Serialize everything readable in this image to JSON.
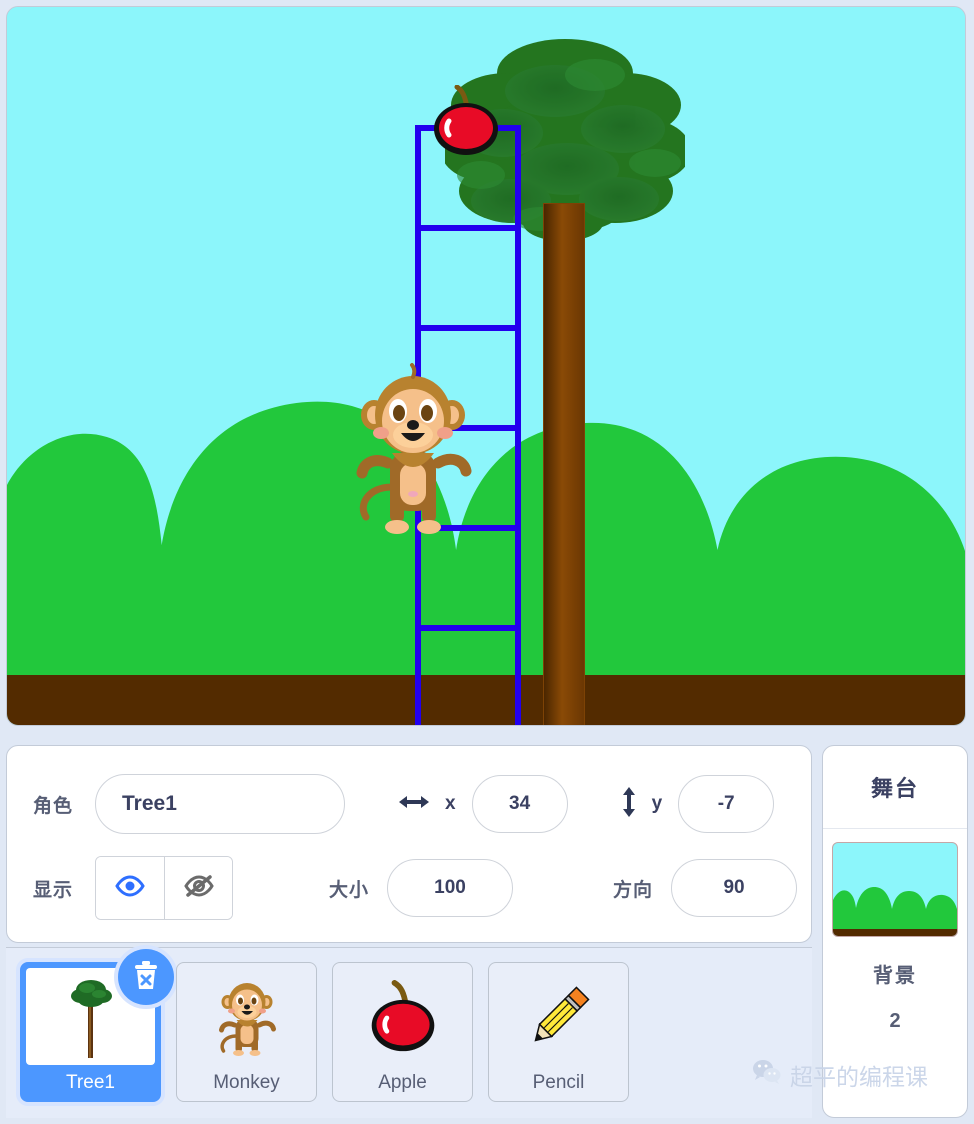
{
  "stage": {
    "sky_color": "#8cf6fb",
    "hill_color": "#22c83c",
    "dirt_color": "#532b00",
    "sprites_on_stage": [
      {
        "name": "tree-sprite",
        "icon": "tree"
      },
      {
        "name": "apple-sprite",
        "icon": "apple"
      },
      {
        "name": "monkey-sprite",
        "icon": "monkey"
      },
      {
        "name": "ladder-pen-drawing",
        "icon": "ladder",
        "color": "#2200ee"
      }
    ]
  },
  "sprite_info": {
    "name_label": "角色",
    "name_value": "Tree1",
    "x_label": "x",
    "x_value": "34",
    "y_label": "y",
    "y_value": "-7",
    "visibility_label": "显示",
    "show_icon": "eye-icon",
    "hide_icon": "eye-slash-icon",
    "size_label": "大小",
    "size_value": "100",
    "direction_label": "方向",
    "direction_value": "90",
    "accent_color": "#4c97ff"
  },
  "stage_panel": {
    "title": "舞台",
    "backdrop_label": "背景",
    "backdrop_count": "2"
  },
  "sprite_list": {
    "delete_icon": "trash-delete-icon",
    "items": [
      {
        "label": "Tree1",
        "icon": "tree-thumbnail",
        "selected": true
      },
      {
        "label": "Monkey",
        "icon": "monkey-thumbnail",
        "selected": false
      },
      {
        "label": "Apple",
        "icon": "apple-thumbnail",
        "selected": false
      },
      {
        "label": "Pencil",
        "icon": "pencil-thumbnail",
        "selected": false
      }
    ]
  },
  "watermark": {
    "icon": "wechat-icon",
    "text": "超平的编程课"
  }
}
